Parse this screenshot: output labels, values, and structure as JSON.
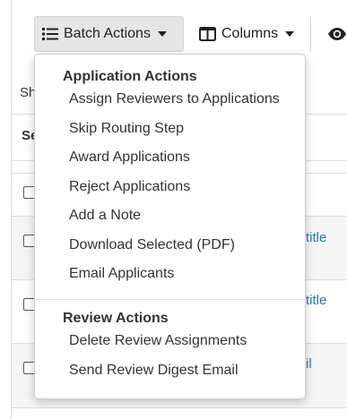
{
  "toolbar": {
    "batch_actions_label": "Batch Actions",
    "columns_label": "Columns"
  },
  "background": {
    "show_text": "Sh",
    "header_text": "Se",
    "links": [
      "title",
      "title",
      "il"
    ]
  },
  "menu": {
    "sections": [
      {
        "header": "Application Actions",
        "items": [
          "Assign Reviewers to Applications",
          "Skip Routing Step",
          "Award Applications",
          "Reject Applications",
          "Add a Note",
          "Download Selected (PDF)",
          "Email Applicants"
        ]
      },
      {
        "header": "Review Actions",
        "items": [
          "Delete Review Assignments",
          "Send Review Digest Email"
        ]
      }
    ]
  },
  "colors": {
    "link": "#2a7ab0",
    "button_bg": "#e6e6e6",
    "text": "#333333"
  },
  "icons": {
    "batch": "list-icon",
    "columns": "columns-icon",
    "view": "eye-icon"
  }
}
